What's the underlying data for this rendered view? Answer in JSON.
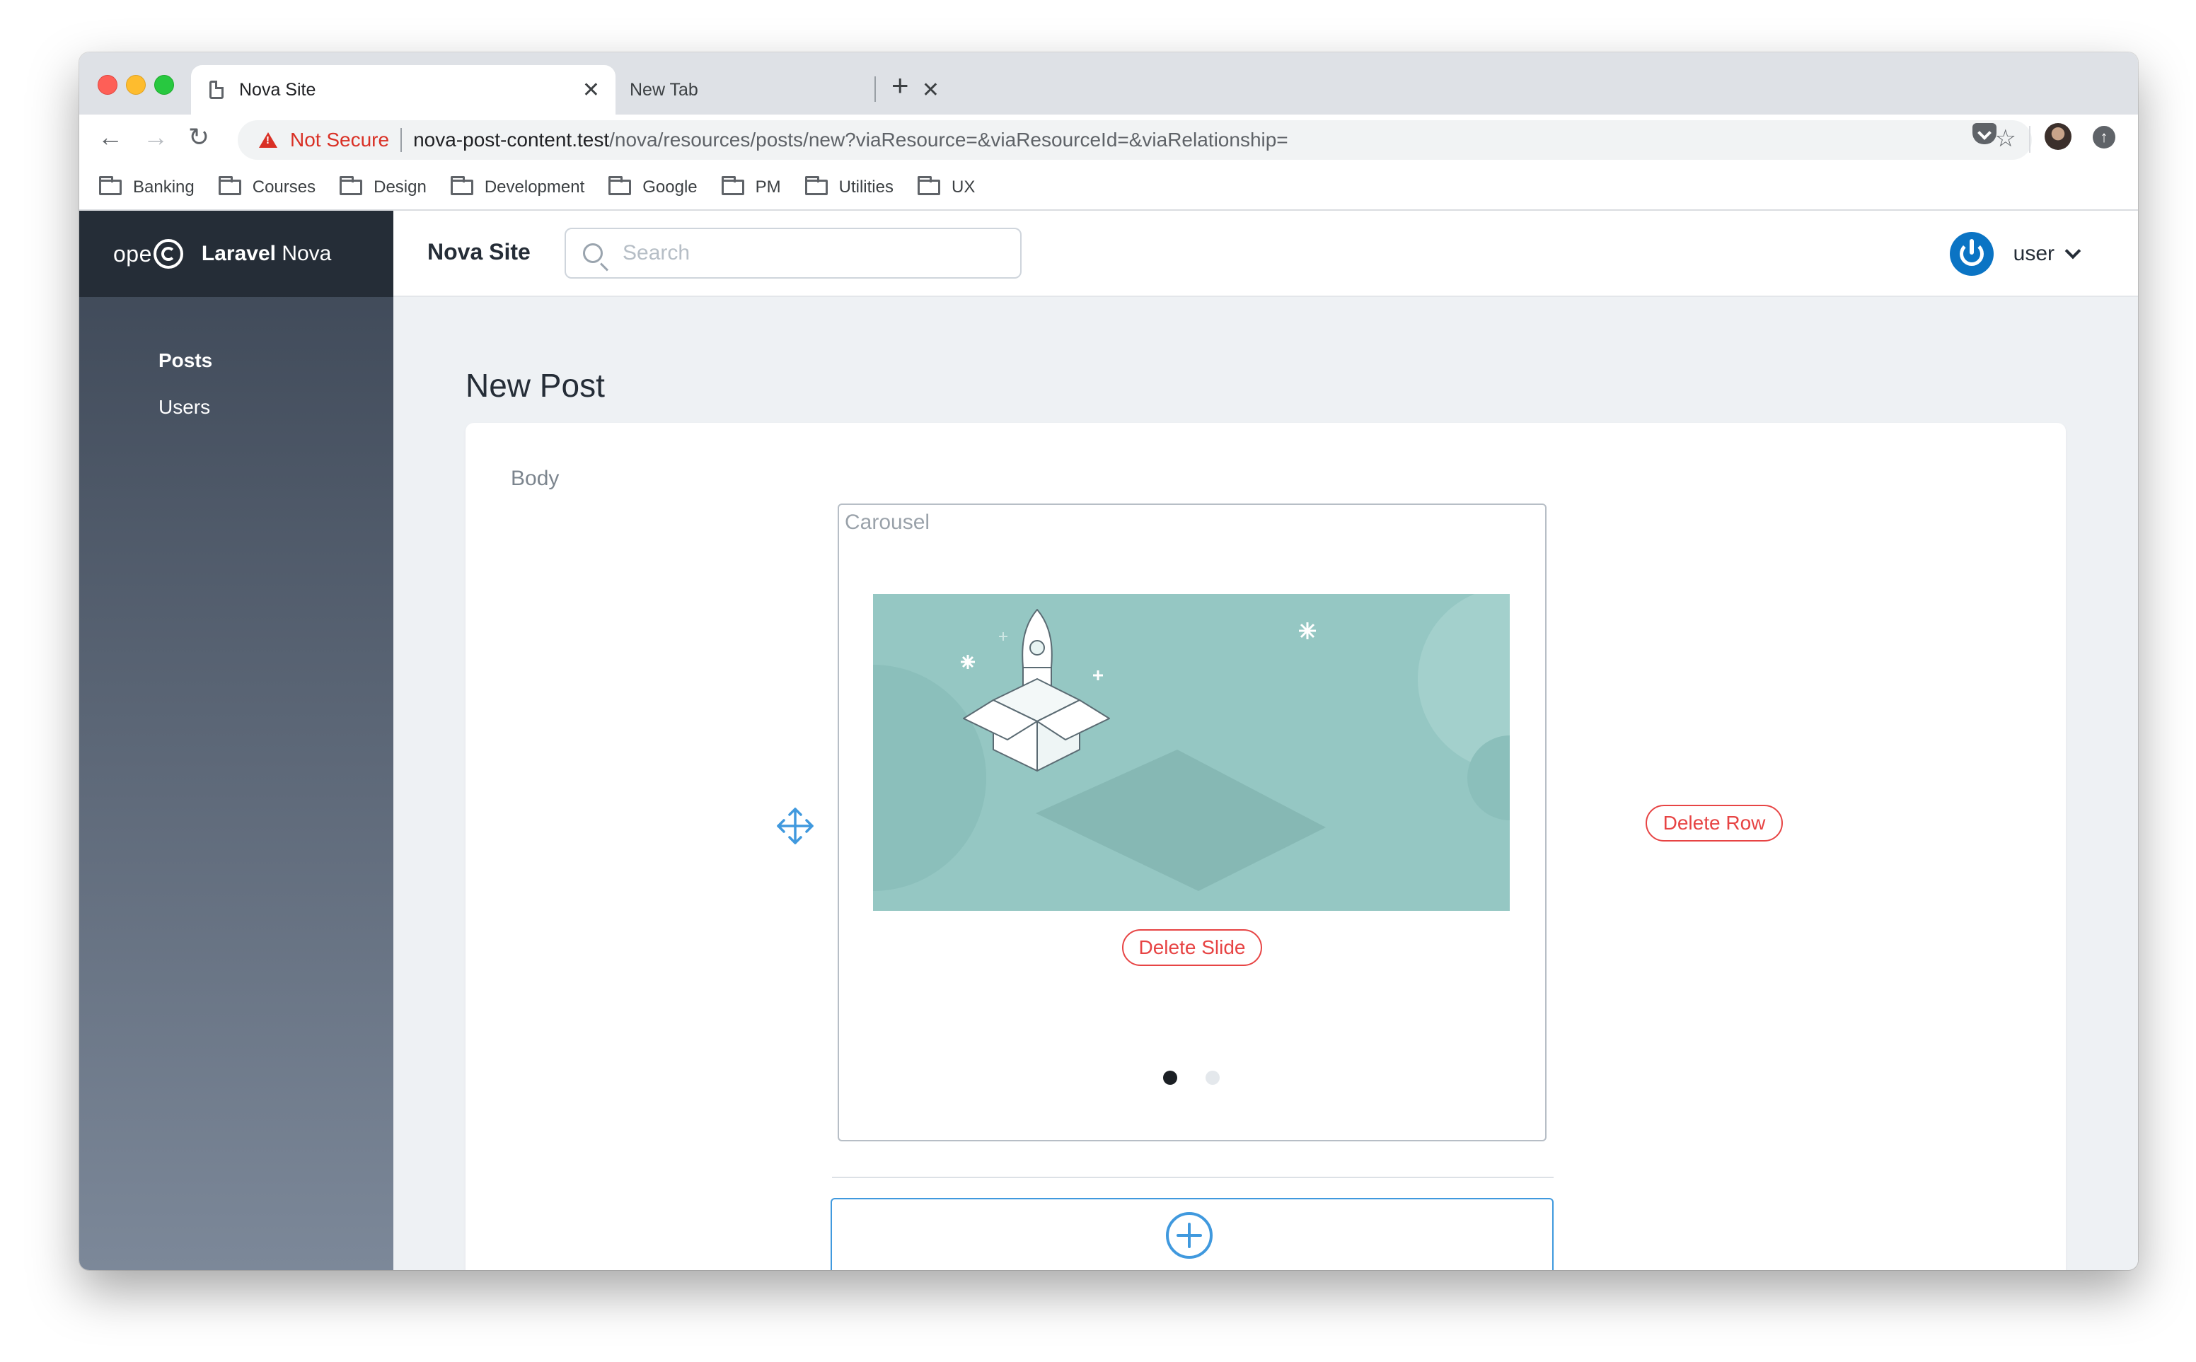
{
  "browser": {
    "tabs": [
      {
        "title": "Nova Site",
        "active": true
      },
      {
        "title": "New Tab",
        "active": false
      }
    ],
    "close_glyph": "✕",
    "new_tab_glyph": "+",
    "security_label": "Not Secure",
    "url_host": "nova-post-content.test",
    "url_path": "/nova/resources/posts/new?viaResource=&viaResourceId=&viaRelationship=",
    "bookmarks": [
      "Banking",
      "Courses",
      "Design",
      "Development",
      "Google",
      "PM",
      "Utilities",
      "UX"
    ]
  },
  "nova": {
    "logo_text": "ope",
    "brand_bold": "Laravel",
    "brand_light": "Nova",
    "site_name": "Nova Site",
    "search_placeholder": "Search",
    "user_label": "user",
    "sidebar": {
      "items": [
        {
          "label": "Posts",
          "active": true
        },
        {
          "label": "Users",
          "active": false
        }
      ]
    },
    "page_title": "New Post",
    "field_label": "Body",
    "carousel": {
      "label": "Carousel",
      "delete_slide_label": "Delete Slide",
      "slide_count": 2,
      "active_slide": 1
    },
    "delete_row_label": "Delete Row"
  },
  "colors": {
    "accent_blue": "#4099de",
    "danger_red": "#e74444",
    "sidebar_top": "#3c4655",
    "sidebar_bottom": "#7c8899",
    "brand_bar": "#252d37",
    "slide_teal": "#95c7c3",
    "power_blue": "#0b74c4"
  }
}
